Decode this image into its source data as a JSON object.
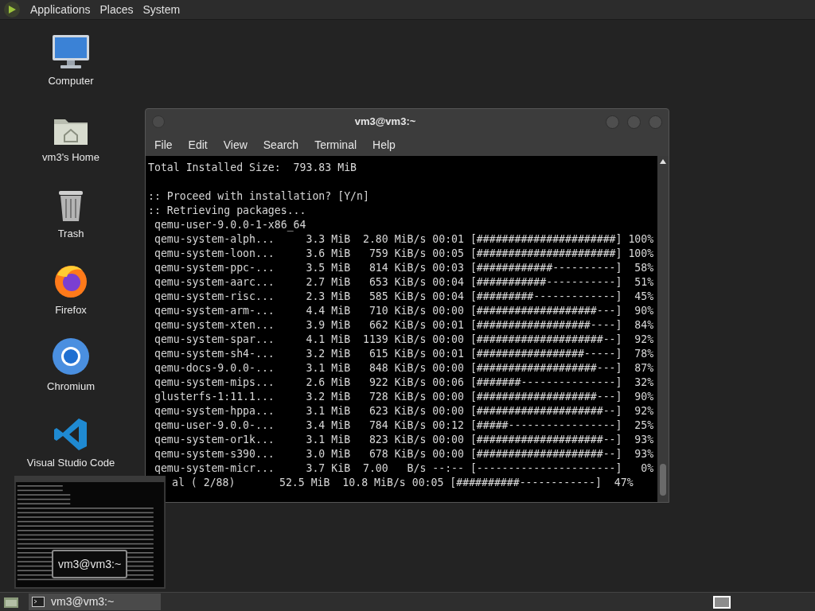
{
  "top_panel": {
    "menus": [
      "Applications",
      "Places",
      "System"
    ]
  },
  "desktop_icons": [
    {
      "kind": "computer",
      "label": "Computer"
    },
    {
      "kind": "home",
      "label": "vm3's Home"
    },
    {
      "kind": "trash",
      "label": "Trash"
    },
    {
      "kind": "firefox",
      "label": "Firefox"
    },
    {
      "kind": "chromium",
      "label": "Chromium"
    },
    {
      "kind": "vscode",
      "label": "Visual Studio Code"
    }
  ],
  "terminal": {
    "title": "vm3@vm3:~",
    "menu": [
      "File",
      "Edit",
      "View",
      "Search",
      "Terminal",
      "Help"
    ],
    "lines": [
      {
        "kind": "line",
        "text": "Total Installed Size:  793.83 MiB"
      },
      {
        "kind": "blank"
      },
      {
        "kind": "line",
        "text": ":: Proceed with installation? [Y/n]"
      },
      {
        "kind": "line",
        "text": ":: Retrieving packages..."
      },
      {
        "kind": "line",
        "text": " qemu-user-9.0.0-1-x86_64"
      },
      {
        "kind": "line",
        "text": " qemu-system-alph...     3.3 MiB  2.80 MiB/s 00:01 [######################] 100%"
      },
      {
        "kind": "line",
        "text": " qemu-system-loon...     3.6 MiB   759 KiB/s 00:05 [######################] 100%"
      },
      {
        "kind": "line",
        "text": " qemu-system-ppc-...     3.5 MiB   814 KiB/s 00:03 [############----------]  58%"
      },
      {
        "kind": "line",
        "text": " qemu-system-aarc...     2.7 MiB   653 KiB/s 00:04 [###########-----------]  51%"
      },
      {
        "kind": "line",
        "text": " qemu-system-risc...     2.3 MiB   585 KiB/s 00:04 [#########-------------]  45%"
      },
      {
        "kind": "line",
        "text": " qemu-system-arm-...     4.4 MiB   710 KiB/s 00:00 [###################---]  90%"
      },
      {
        "kind": "line",
        "text": " qemu-system-xten...     3.9 MiB   662 KiB/s 00:01 [##################----]  84%"
      },
      {
        "kind": "line",
        "text": " qemu-system-spar...     4.1 MiB  1139 KiB/s 00:00 [####################--]  92%"
      },
      {
        "kind": "line",
        "text": " qemu-system-sh4-...     3.2 MiB   615 KiB/s 00:01 [#################-----]  78%"
      },
      {
        "kind": "line",
        "text": " qemu-docs-9.0.0-...     3.1 MiB   848 KiB/s 00:00 [###################---]  87%"
      },
      {
        "kind": "line",
        "text": " qemu-system-mips...     2.6 MiB   922 KiB/s 00:06 [#######---------------]  32%"
      },
      {
        "kind": "line",
        "text": " glusterfs-1:11.1...     3.2 MiB   728 KiB/s 00:00 [###################---]  90%"
      },
      {
        "kind": "line",
        "text": " qemu-system-hppa...     3.1 MiB   623 KiB/s 00:00 [####################--]  92%"
      },
      {
        "kind": "line",
        "text": " qemu-user-9.0.0-...     3.4 MiB   784 KiB/s 00:12 [#####-----------------]  25%"
      },
      {
        "kind": "line",
        "text": " qemu-system-or1k...     3.1 MiB   823 KiB/s 00:00 [####################--]  93%"
      },
      {
        "kind": "line",
        "text": " qemu-system-s390...     3.0 MiB   678 KiB/s 00:00 [####################--]  93%"
      },
      {
        "kind": "line",
        "text": " qemu-system-micr...     3.7 KiB  7.00   B/s --:-- [----------------------]   0%"
      },
      {
        "kind": "covered",
        "text": "al ( 2/88)       52.5 MiB  10.8 MiB/s 00:05 [##########------------]  47%"
      }
    ]
  },
  "preview": {
    "tooltip": "vm3@vm3:~"
  },
  "taskbar": {
    "tasks": [
      {
        "label": "vm3@vm3:~",
        "selected": true
      }
    ]
  }
}
